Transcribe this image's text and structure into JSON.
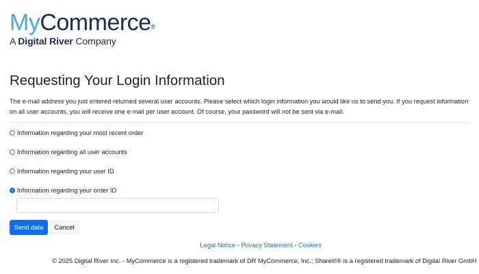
{
  "logo": {
    "my": "My",
    "commerce": "Commerce",
    "reg": "®",
    "sub_prefix": "A",
    "sub_brand": "Digital River",
    "sub_suffix": "Company"
  },
  "title": "Requesting Your Login Information",
  "description": "The e-mail address you just entered returned several user accounts. Please select which login information you would like us to send you. If you request information on all user accounts, you will receive one e-mail per user account. Of course, your password will not be sent via e-mail.",
  "options": [
    {
      "label": "Information regarding your most recent order",
      "checked": false
    },
    {
      "label": "Information regarding all user accounts",
      "checked": false
    },
    {
      "label": "Information regarding your user ID",
      "checked": false
    },
    {
      "label": "Information regarding your order ID",
      "checked": true
    }
  ],
  "order_id_input": {
    "value": "",
    "placeholder": ""
  },
  "buttons": {
    "send": "Send data",
    "cancel": "Cancel"
  },
  "footer": {
    "legal": "Legal Notice",
    "privacy": "Privacy Statement",
    "cookies": "Cookies",
    "separator": " - ",
    "copyright": "© 2025 Digital River Inc. - MyCommerce is a registered trademark of DR MyCommerce, Inc.; Shareit!® is a registered trademark of Digital River GmbH"
  },
  "colors": {
    "primary": "#0d6efd",
    "logo_light": "#4aa8dd",
    "logo_dark": "#1b2a5b",
    "link": "#2e6fa3"
  }
}
